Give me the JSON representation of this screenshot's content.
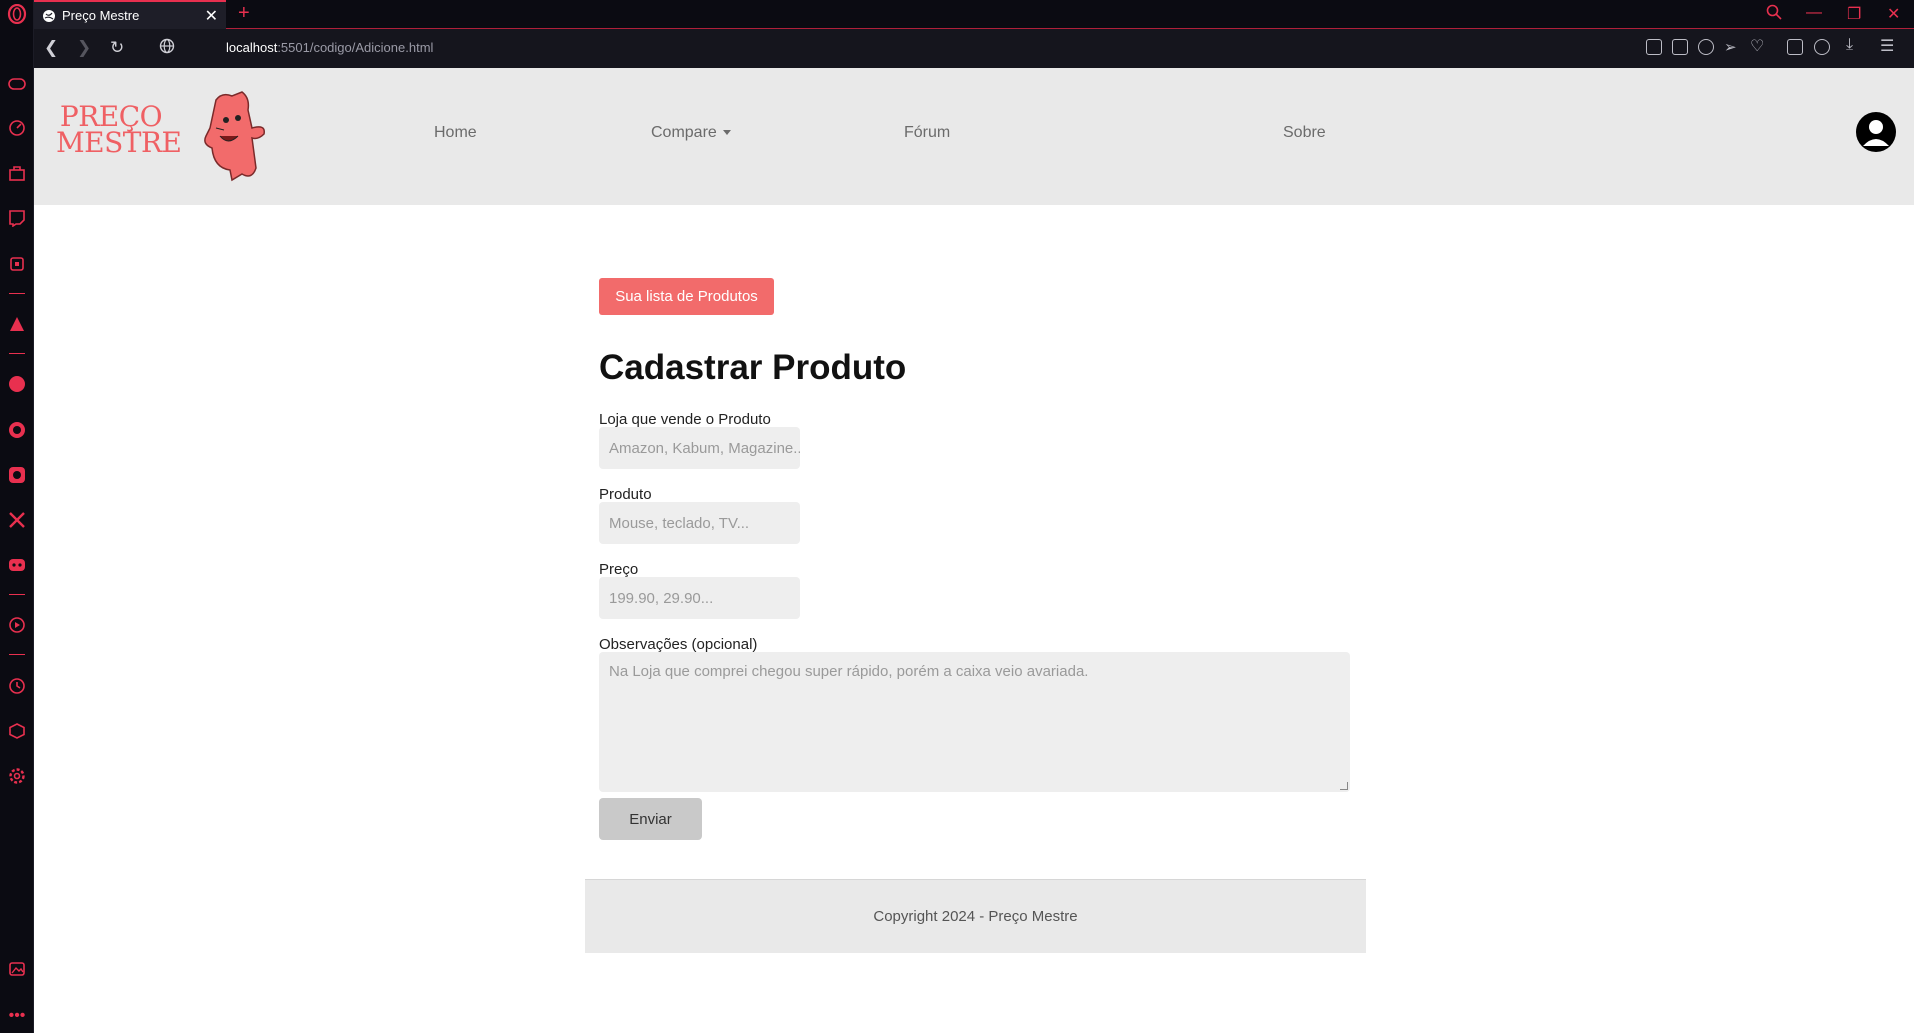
{
  "browser": {
    "tab_title": "Preço Mestre",
    "url_host": "localhost",
    "url_path": ":5501/codigo/Adicione.html",
    "accent": "#e8304f"
  },
  "header": {
    "logo_line1": "PREÇO",
    "logo_line2": "MESTRE",
    "nav": {
      "home": "Home",
      "compare": "Compare",
      "forum": "Fórum",
      "about": "Sobre"
    },
    "background": "#e9e9e9"
  },
  "main": {
    "list_button": "Sua lista de Produtos",
    "list_button_color": "#f26b6b",
    "title": "Cadastrar Produto",
    "fields": {
      "store_label": "Loja que vende o Produto",
      "store_placeholder": "Amazon, Kabum, Magazine...",
      "product_label": "Produto",
      "product_placeholder": "Mouse, teclado, TV...",
      "price_label": "Preço",
      "price_placeholder": "199.90, 29.90...",
      "notes_label": "Observações (opcional)",
      "notes_placeholder": "Na Loja que comprei chegou super rápido, porém a caixa veio avariada."
    },
    "submit": "Enviar"
  },
  "footer": {
    "copyright": "Copyright 2024 - Preço Mestre"
  },
  "icons": {
    "sidebar": [
      "opera-logo-icon",
      "gamepad-icon",
      "speedometer-icon",
      "shopping-bag-icon",
      "twitch-icon",
      "chip-icon",
      "aria-icon",
      "messenger-icon",
      "whatsapp-icon",
      "instagram-icon",
      "x-twitter-icon",
      "discord-icon",
      "player-icon",
      "history-icon",
      "cube-icon",
      "settings-icon",
      "gallery-icon",
      "more-icon"
    ],
    "toolbar": [
      "edit-icon",
      "camera-icon",
      "block-icon",
      "send-icon",
      "heart-icon",
      "extensions-icon",
      "profile-icon",
      "download-icon",
      "menu-icon"
    ]
  }
}
